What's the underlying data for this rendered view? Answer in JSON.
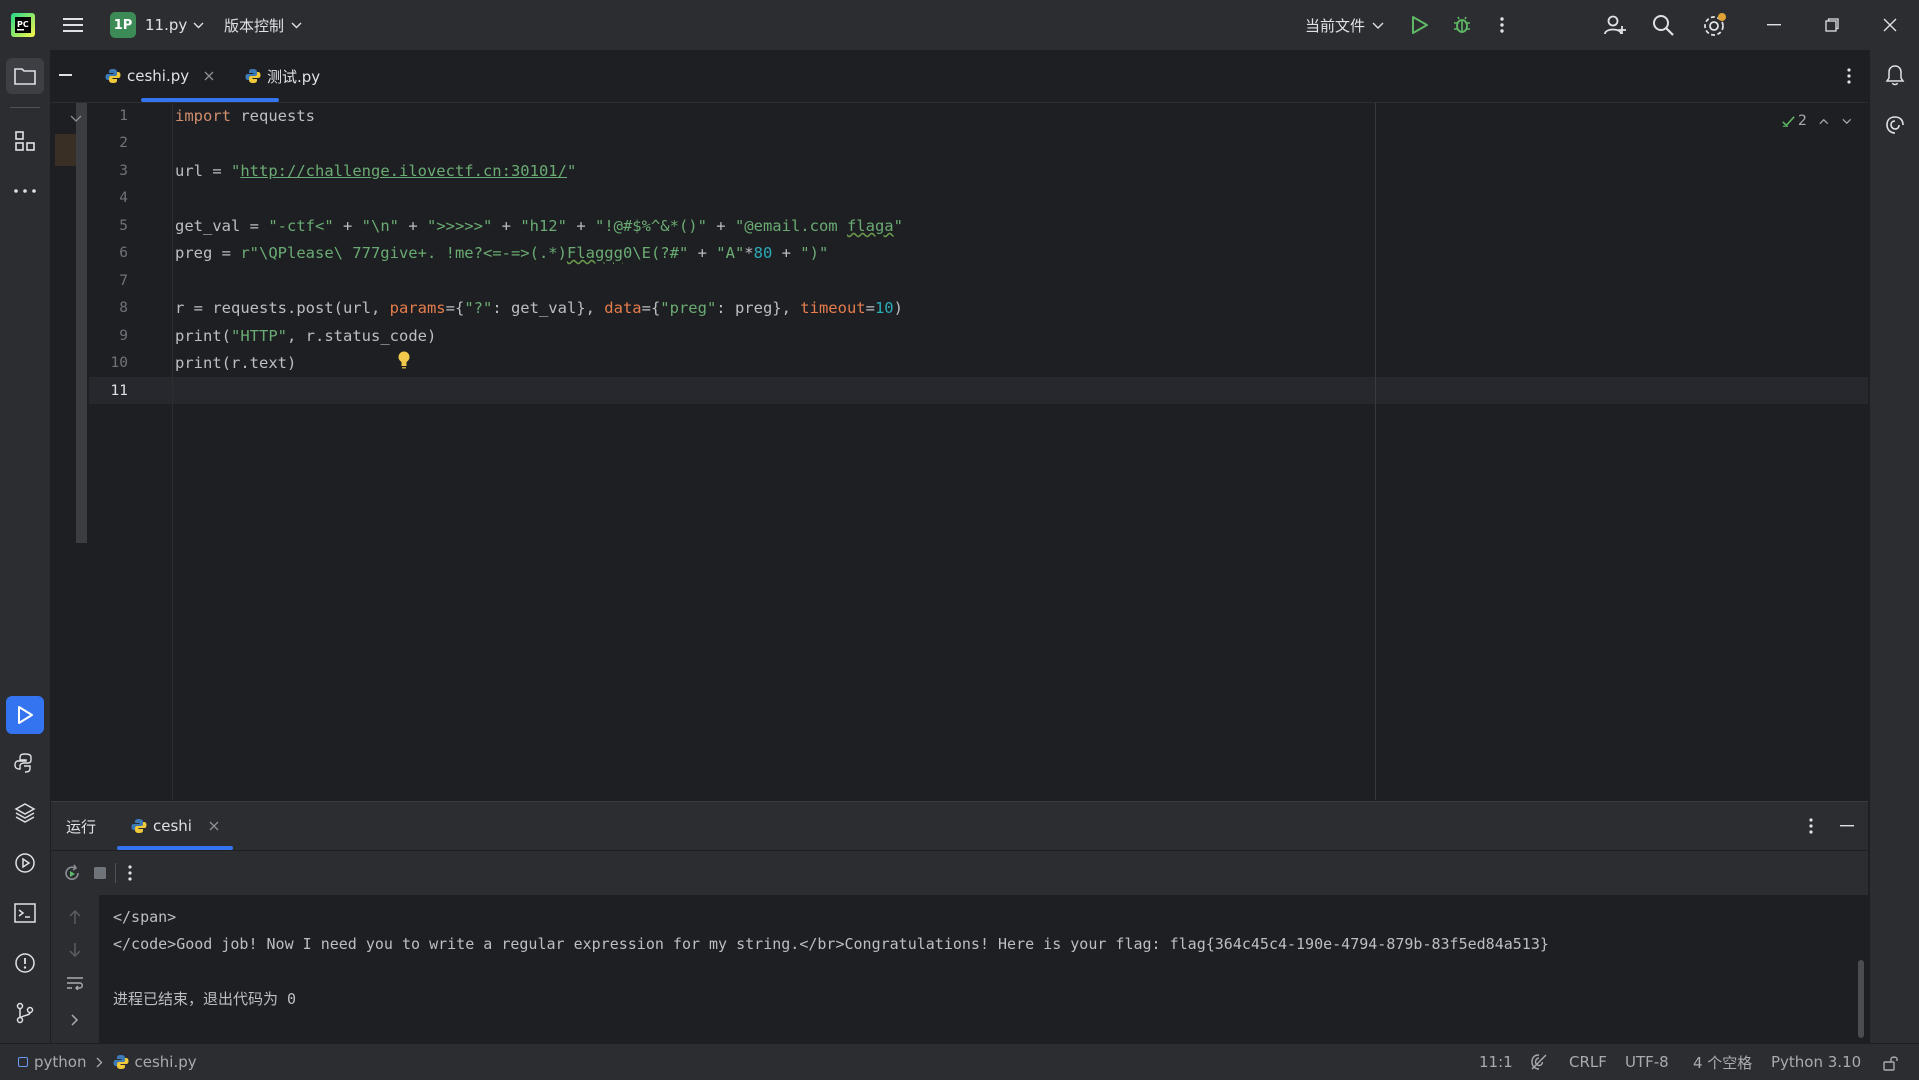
{
  "titlebar": {
    "project_badge": "1P",
    "project_name": "11.py",
    "vcs_menu": "版本控制",
    "run_config": "当前文件"
  },
  "tabs": [
    {
      "label": "ceshi.py",
      "active": true
    },
    {
      "label": "测试.py",
      "active": false
    }
  ],
  "editor": {
    "problems_count": "2",
    "line_numbers": [
      "1",
      "2",
      "3",
      "4",
      "5",
      "6",
      "7",
      "8",
      "9",
      "10",
      "11"
    ],
    "current_line": "11"
  },
  "run_panel": {
    "title": "运行",
    "tab_label": "ceshi",
    "output": [
      "</span>",
      "</code>Good job! Now I need you to write a regular expression for my string.</br>Congratulations! Here is your flag: flag{364c45c4-190e-4794-879b-83f5ed84a513}",
      "",
      "进程已结束，退出代码为 0"
    ]
  },
  "statusbar": {
    "breadcrumb_root": "python",
    "breadcrumb_file": "ceshi.py",
    "position": "11:1",
    "line_ending": "CRLF",
    "encoding": "UTF-8",
    "indent": "4 个空格",
    "interpreter": "Python 3.10"
  },
  "colors": {
    "accent": "#3574f0",
    "keyword": "#cf8e6d",
    "string": "#6aab73",
    "number": "#2aacb8",
    "param": "#e57d4c"
  }
}
